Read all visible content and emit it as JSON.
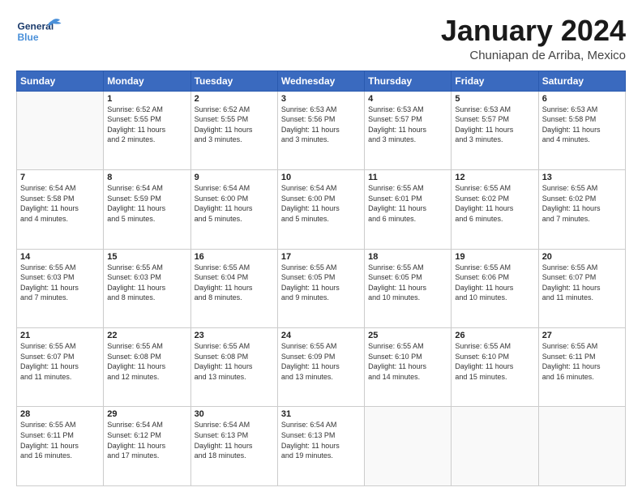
{
  "header": {
    "logo_line1": "General",
    "logo_line2": "Blue",
    "title": "January 2024",
    "subtitle": "Chuniapan de Arriba, Mexico"
  },
  "days_of_week": [
    "Sunday",
    "Monday",
    "Tuesday",
    "Wednesday",
    "Thursday",
    "Friday",
    "Saturday"
  ],
  "weeks": [
    [
      {
        "day": "",
        "info": ""
      },
      {
        "day": "1",
        "info": "Sunrise: 6:52 AM\nSunset: 5:55 PM\nDaylight: 11 hours\nand 2 minutes."
      },
      {
        "day": "2",
        "info": "Sunrise: 6:52 AM\nSunset: 5:55 PM\nDaylight: 11 hours\nand 3 minutes."
      },
      {
        "day": "3",
        "info": "Sunrise: 6:53 AM\nSunset: 5:56 PM\nDaylight: 11 hours\nand 3 minutes."
      },
      {
        "day": "4",
        "info": "Sunrise: 6:53 AM\nSunset: 5:57 PM\nDaylight: 11 hours\nand 3 minutes."
      },
      {
        "day": "5",
        "info": "Sunrise: 6:53 AM\nSunset: 5:57 PM\nDaylight: 11 hours\nand 3 minutes."
      },
      {
        "day": "6",
        "info": "Sunrise: 6:53 AM\nSunset: 5:58 PM\nDaylight: 11 hours\nand 4 minutes."
      }
    ],
    [
      {
        "day": "7",
        "info": "Sunrise: 6:54 AM\nSunset: 5:58 PM\nDaylight: 11 hours\nand 4 minutes."
      },
      {
        "day": "8",
        "info": "Sunrise: 6:54 AM\nSunset: 5:59 PM\nDaylight: 11 hours\nand 5 minutes."
      },
      {
        "day": "9",
        "info": "Sunrise: 6:54 AM\nSunset: 6:00 PM\nDaylight: 11 hours\nand 5 minutes."
      },
      {
        "day": "10",
        "info": "Sunrise: 6:54 AM\nSunset: 6:00 PM\nDaylight: 11 hours\nand 5 minutes."
      },
      {
        "day": "11",
        "info": "Sunrise: 6:55 AM\nSunset: 6:01 PM\nDaylight: 11 hours\nand 6 minutes."
      },
      {
        "day": "12",
        "info": "Sunrise: 6:55 AM\nSunset: 6:02 PM\nDaylight: 11 hours\nand 6 minutes."
      },
      {
        "day": "13",
        "info": "Sunrise: 6:55 AM\nSunset: 6:02 PM\nDaylight: 11 hours\nand 7 minutes."
      }
    ],
    [
      {
        "day": "14",
        "info": "Sunrise: 6:55 AM\nSunset: 6:03 PM\nDaylight: 11 hours\nand 7 minutes."
      },
      {
        "day": "15",
        "info": "Sunrise: 6:55 AM\nSunset: 6:03 PM\nDaylight: 11 hours\nand 8 minutes."
      },
      {
        "day": "16",
        "info": "Sunrise: 6:55 AM\nSunset: 6:04 PM\nDaylight: 11 hours\nand 8 minutes."
      },
      {
        "day": "17",
        "info": "Sunrise: 6:55 AM\nSunset: 6:05 PM\nDaylight: 11 hours\nand 9 minutes."
      },
      {
        "day": "18",
        "info": "Sunrise: 6:55 AM\nSunset: 6:05 PM\nDaylight: 11 hours\nand 10 minutes."
      },
      {
        "day": "19",
        "info": "Sunrise: 6:55 AM\nSunset: 6:06 PM\nDaylight: 11 hours\nand 10 minutes."
      },
      {
        "day": "20",
        "info": "Sunrise: 6:55 AM\nSunset: 6:07 PM\nDaylight: 11 hours\nand 11 minutes."
      }
    ],
    [
      {
        "day": "21",
        "info": "Sunrise: 6:55 AM\nSunset: 6:07 PM\nDaylight: 11 hours\nand 11 minutes."
      },
      {
        "day": "22",
        "info": "Sunrise: 6:55 AM\nSunset: 6:08 PM\nDaylight: 11 hours\nand 12 minutes."
      },
      {
        "day": "23",
        "info": "Sunrise: 6:55 AM\nSunset: 6:08 PM\nDaylight: 11 hours\nand 13 minutes."
      },
      {
        "day": "24",
        "info": "Sunrise: 6:55 AM\nSunset: 6:09 PM\nDaylight: 11 hours\nand 13 minutes."
      },
      {
        "day": "25",
        "info": "Sunrise: 6:55 AM\nSunset: 6:10 PM\nDaylight: 11 hours\nand 14 minutes."
      },
      {
        "day": "26",
        "info": "Sunrise: 6:55 AM\nSunset: 6:10 PM\nDaylight: 11 hours\nand 15 minutes."
      },
      {
        "day": "27",
        "info": "Sunrise: 6:55 AM\nSunset: 6:11 PM\nDaylight: 11 hours\nand 16 minutes."
      }
    ],
    [
      {
        "day": "28",
        "info": "Sunrise: 6:55 AM\nSunset: 6:11 PM\nDaylight: 11 hours\nand 16 minutes."
      },
      {
        "day": "29",
        "info": "Sunrise: 6:54 AM\nSunset: 6:12 PM\nDaylight: 11 hours\nand 17 minutes."
      },
      {
        "day": "30",
        "info": "Sunrise: 6:54 AM\nSunset: 6:13 PM\nDaylight: 11 hours\nand 18 minutes."
      },
      {
        "day": "31",
        "info": "Sunrise: 6:54 AM\nSunset: 6:13 PM\nDaylight: 11 hours\nand 19 minutes."
      },
      {
        "day": "",
        "info": ""
      },
      {
        "day": "",
        "info": ""
      },
      {
        "day": "",
        "info": ""
      }
    ]
  ]
}
